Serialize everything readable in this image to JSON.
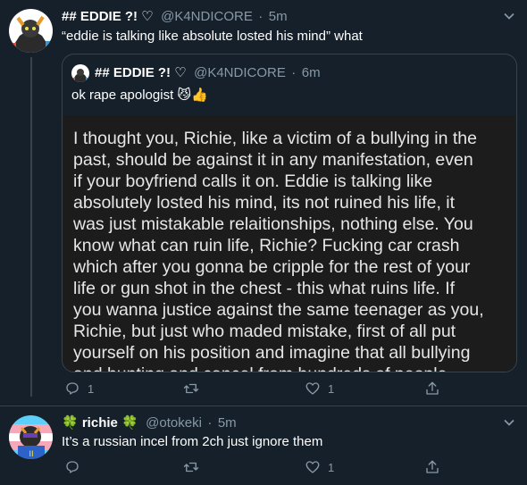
{
  "tweet1": {
    "display_name": "## EDDIE ?! ♡",
    "handle": "@K4NDICORE",
    "sep": "·",
    "time": "5m",
    "text": "“eddie is talking like absolute losted his mind” what",
    "quote": {
      "display_name": "## EDDIE ?! ♡",
      "handle": "@K4NDICORE",
      "sep": "·",
      "time": "6m",
      "text": "ok rape apologist 😼👍",
      "image_lines": [
        "I thought you, Richie, like a victim of a bullying in the",
        "past, should be against it in any manifestation, even",
        "if your boyfriend calls it on. Eddie is talking like",
        "absolutely losted his mind, its not ruined his life, it",
        "was just mistakable relaitionships, nothing else. You",
        "know what can ruin life, Richie? Fucking car crash",
        "which after you gonna be cripple for the rest of your",
        "life or  gun shot in the chest - this what ruins life. If",
        "you wanna justice against the same teenager as you,",
        "Richie, but just who maded mistake, first of all put",
        "yourself on his position and imagine that all bullying",
        "and hunting and cancel from hundreds of people"
      ]
    },
    "actions": {
      "replies": "1",
      "likes": "1"
    }
  },
  "tweet2": {
    "display_name": "🍀 richie 🍀",
    "handle": "@otokeki",
    "sep": "·",
    "time": "5m",
    "text": "It’s a russian incel from 2ch just ignore them",
    "actions": {
      "replies": "",
      "likes": "1"
    }
  },
  "colors": {
    "background": "#15202b",
    "secondary_text": "#8899a6",
    "border": "#38444d"
  }
}
